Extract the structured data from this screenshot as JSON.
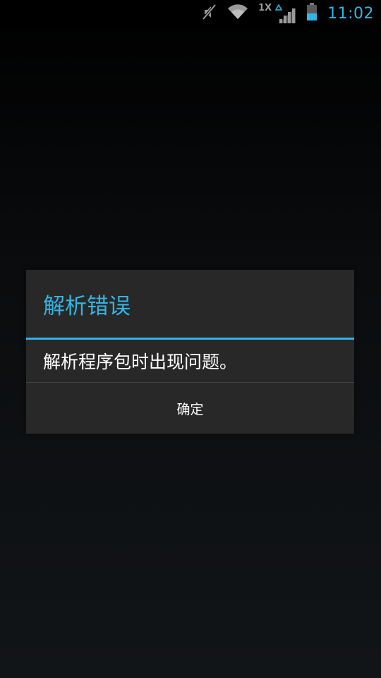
{
  "status_bar": {
    "time": "11:02",
    "icons": [
      "mute-icon",
      "wifi-icon",
      "network-1x-icon",
      "signal-icon",
      "battery-icon"
    ],
    "network_label": "1X",
    "accent_color": "#33b5e5"
  },
  "dialog": {
    "title": "解析错误",
    "message": "解析程序包时出现问题。",
    "ok_button": "确定",
    "accent_color": "#33b5e5",
    "background_color": "#282828"
  }
}
